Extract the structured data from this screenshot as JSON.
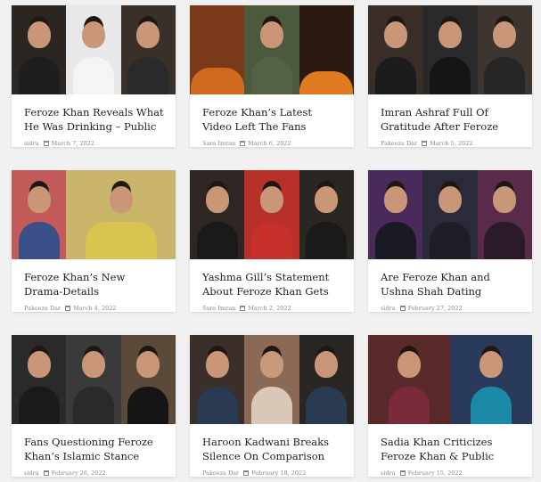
{
  "articles": [
    {
      "title": "Feroze Khan Reveals What He Was Drinking – Public Enraged",
      "author": "sidra",
      "date": "March 7, 2022",
      "thumb": [
        "#2b2622",
        "#e8e8e8",
        "#3a302a"
      ],
      "thumb_alt": "feroze-khan-photo-thumbnail"
    },
    {
      "title": "Feroze Khan’s Latest Video Left The Fans Startled",
      "author": "Sara Imran",
      "date": "March 6, 2022",
      "thumb": [
        "#7a3a1a",
        "#4a5a3a",
        "#2a1a12"
      ],
      "thumb_alt": "feroze-khan-video-thumbnail"
    },
    {
      "title": "Imran Ashraf Full Of Gratitude After Feroze Khan Defended...",
      "author": "Pakeeza Dar",
      "date": "March 5, 2022",
      "thumb": [
        "#3a2e28",
        "#2a2a2a",
        "#3d3630"
      ],
      "thumb_alt": "imran-ashraf-thumbnail"
    },
    {
      "title": "Feroze Khan’s New Drama-Details",
      "author": "Pakeeza Dar",
      "date": "March 4, 2022",
      "thumb": [
        "#c25a5a",
        "#c9b56a",
        "#7a6a3a"
      ],
      "thumb_alt": "drama-thumbnail"
    },
    {
      "title": "Yashma Gill’s Statement About Feroze Khan Gets Mixed...",
      "author": "Sara Imran",
      "date": "March 2, 2022",
      "thumb": [
        "#2d2622",
        "#b8302a",
        "#2a2622"
      ],
      "thumb_alt": "yashma-gill-thumbnail"
    },
    {
      "title": "Are Feroze Khan and Ushna Shah Dating",
      "author": "sidra",
      "date": "February 27, 2022",
      "thumb": [
        "#4a2a5a",
        "#2a2a3a",
        "#5a2a4a"
      ],
      "thumb_alt": "ushna-shah-thumbnail"
    },
    {
      "title": "Fans Questioning Feroze Khan’s Islamic Stance after...",
      "author": "sidra",
      "date": "February 26, 2022",
      "thumb": [
        "#2a2a2a",
        "#3a3a3a",
        "#5a4a3a"
      ],
      "thumb_alt": "islamic-stance-thumbnail"
    },
    {
      "title": "Haroon Kadwani Breaks Silence On Comparison With...",
      "author": "Pakeeza Dar",
      "date": "February 18, 2022",
      "thumb": [
        "#3a2f2a",
        "#8a6a55",
        "#2a2624"
      ],
      "thumb_alt": "haroon-kadwani-thumbnail"
    },
    {
      "title": "Sadia Khan Criticizes Feroze Khan & Public Agrees",
      "author": "sidra",
      "date": "February 15, 2022",
      "thumb": [
        "#5a2a2a",
        "#2a3a5a",
        "#3a2a2a"
      ],
      "thumb_alt": "sadia-khan-thumbnail"
    }
  ]
}
